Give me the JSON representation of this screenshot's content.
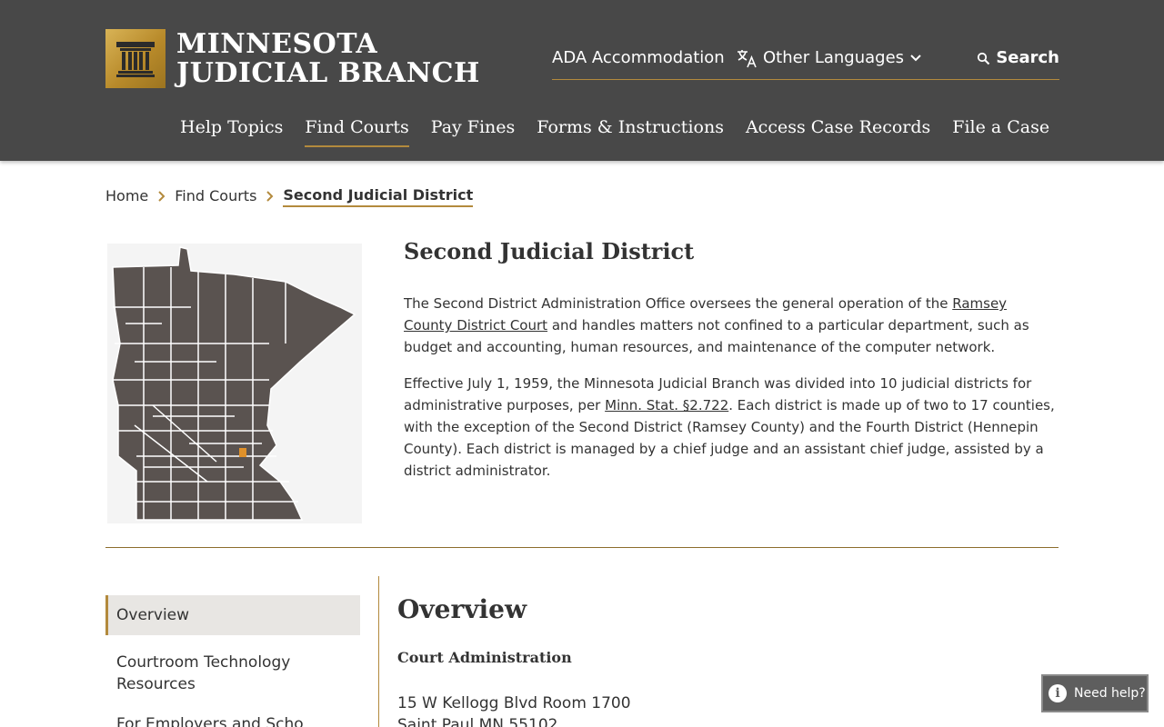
{
  "header": {
    "logo_line1": "MINNESOTA",
    "logo_line2": "JUDICIAL BRANCH",
    "utility": {
      "ada": "ADA Accommodation",
      "languages": "Other Languages",
      "search": "Search"
    },
    "nav": [
      "Help Topics",
      "Find Courts",
      "Pay Fines",
      "Forms & Instructions",
      "Access Case Records",
      "File a Case"
    ]
  },
  "breadcrumb": {
    "home": "Home",
    "find_courts": "Find Courts",
    "current": "Second Judicial District"
  },
  "hero": {
    "title": "Second Judicial District",
    "p1_a": "The Second District Administration Office oversees the general operation of the ",
    "p1_link": "Ramsey County District Court",
    "p1_b": " and handles matters not confined to a particular department, such as budget and accounting, human resources, and maintenance of the computer network.",
    "p2_a": "Effective July 1, 1959, the Minnesota Judicial Branch was divided into 10 judicial districts for administrative purposes, per ",
    "p2_link": "Minn. Stat. §2.722",
    "p2_b": ".  Each district is made up of two to 17 counties, with the exception of the Second District (Ramsey County) and the Fourth District (Hennepin County).  Each district is managed by a chief judge and an assistant chief judge, assisted by a district administrator."
  },
  "side_nav": {
    "overview": "Overview",
    "courtroom": "Courtroom Technology Resources",
    "partial": "For Employers and Scho"
  },
  "content": {
    "title": "Overview",
    "subtitle": "Court Administration",
    "address1": "15 W Kellogg Blvd Room 1700",
    "address2": "Saint Paul MN 55102"
  },
  "help": {
    "label": "Need help?"
  },
  "colors": {
    "header_bg": "#484848",
    "accent_gold": "#b38a3d",
    "map_county": "#5a5350",
    "map_highlight": "#e0912a"
  },
  "icons": [
    "pillar-logo-icon",
    "translate-icon",
    "chevron-down-icon",
    "search-icon",
    "chevron-right-icon",
    "info-icon"
  ]
}
